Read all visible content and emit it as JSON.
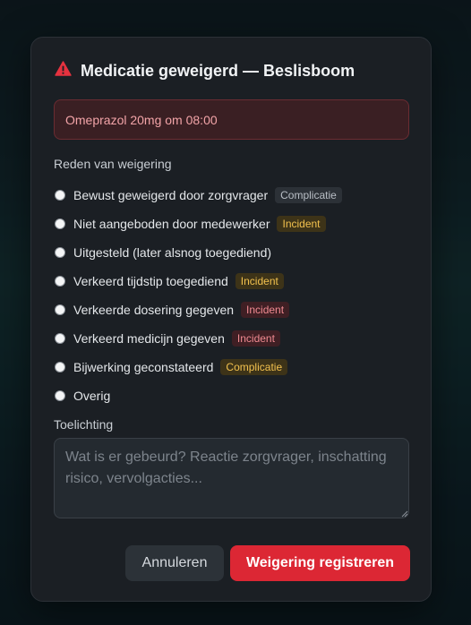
{
  "dialog": {
    "title": "Medicatie geweigerd — Beslisboom",
    "warning_icon": "warning-triangle-icon",
    "accent_color": "#dc2734"
  },
  "medication": {
    "text": "Omeprazol 20mg om 08:00"
  },
  "reasons": {
    "label": "Reden van weigering",
    "items": [
      {
        "label": "Bewust geweigerd door zorgvrager",
        "tag": "Complicatie",
        "tag_style": "neutral"
      },
      {
        "label": "Niet aangeboden door medewerker",
        "tag": "Incident",
        "tag_style": "amber"
      },
      {
        "label": "Uitgesteld (later alsnog toegediend)",
        "tag": "",
        "tag_style": ""
      },
      {
        "label": "Verkeerd tijdstip toegediend",
        "tag": "Incident",
        "tag_style": "amber"
      },
      {
        "label": "Verkeerde dosering gegeven",
        "tag": "Incident",
        "tag_style": "red"
      },
      {
        "label": "Verkeerd medicijn gegeven",
        "tag": "Incident",
        "tag_style": "red"
      },
      {
        "label": "Bijwerking geconstateerd",
        "tag": "Complicatie",
        "tag_style": "amber"
      },
      {
        "label": "Overig",
        "tag": "",
        "tag_style": ""
      }
    ]
  },
  "notes": {
    "label": "Toelichting",
    "placeholder": "Wat is er gebeurd? Reactie zorgvrager, inschatting risico, vervolgacties...",
    "value": ""
  },
  "actions": {
    "cancel_label": "Annuleren",
    "submit_label": "Weigering registreren"
  }
}
